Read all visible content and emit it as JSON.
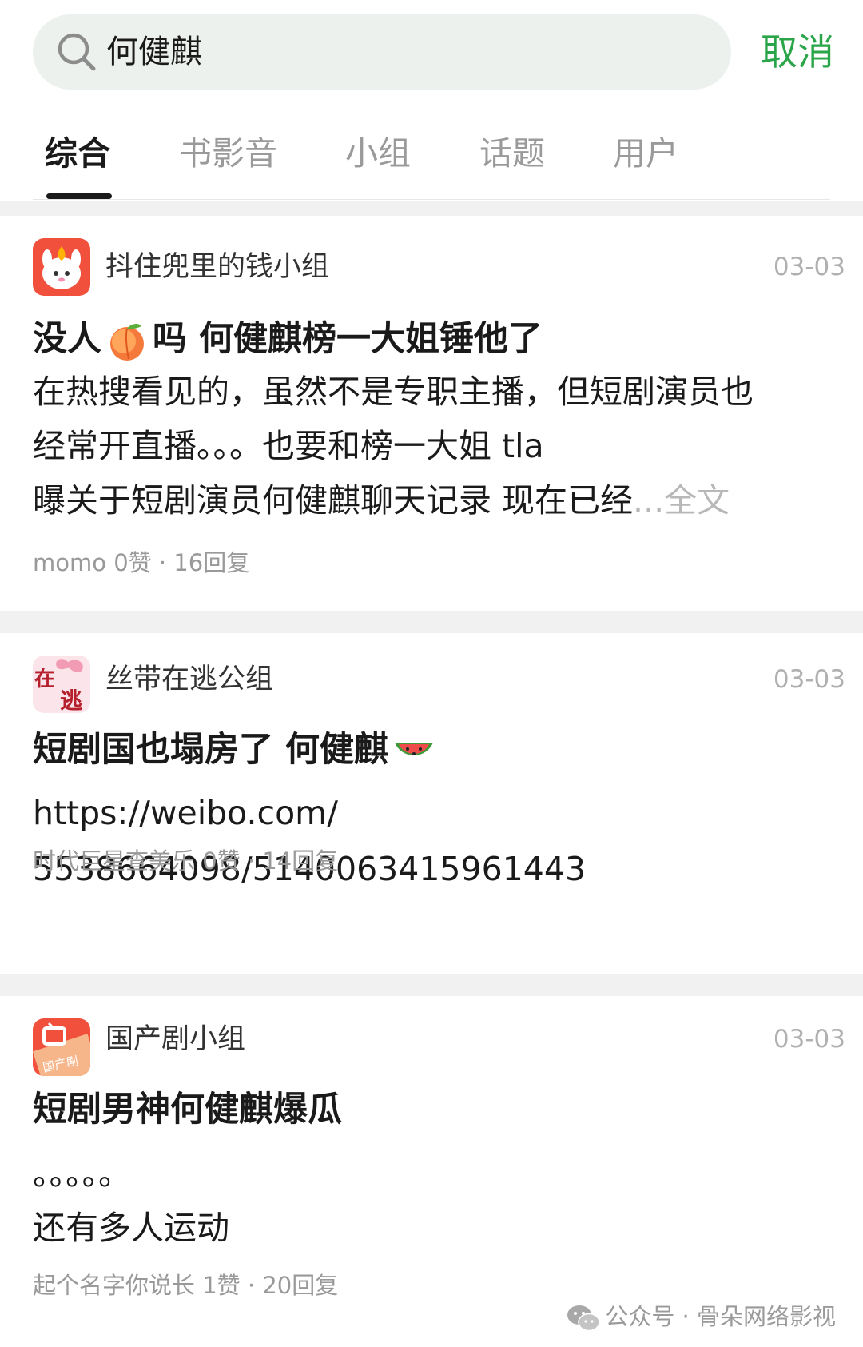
{
  "search": {
    "query": "何健麒",
    "cancel_label": "取消"
  },
  "tabs": [
    {
      "label": "综合"
    },
    {
      "label": "书影音"
    },
    {
      "label": "小组"
    },
    {
      "label": "话题"
    },
    {
      "label": "用户"
    }
  ],
  "posts": [
    {
      "group_name": "抖住兜里的钱小组",
      "date": "03-03",
      "title_before": "没人",
      "title_after": "吗 何健麒榜一大姐锤他了",
      "title_emoji": "peach-icon",
      "body_lines": [
        "在热搜看见的，虽然不是专职主播，但短剧演员也",
        "经常开直播。。。也要和榜一大姐 tla",
        " 曝关于短剧演员何健麒聊天记录 现在已经"
      ],
      "more_label": "...全文",
      "meta": "momo 0赞 · 16回复"
    },
    {
      "group_name": "丝带在逃公组",
      "date": "03-03",
      "title_before": "短剧国也塌房了  何健麒",
      "title_emoji": "watermelon-icon",
      "body_lines": [
        "https://weibo.com/",
        "5538664098/5140063415961443"
      ],
      "meta": "时代巨星查美乐 0赞 · 14回复"
    },
    {
      "group_name": "国产剧小组",
      "date": "03-03",
      "title_before": "短剧男神何健麒爆瓜",
      "body_lines": [
        "。。。。。",
        "还有多人运动"
      ],
      "meta": "起个名字你说长 1赞 · 20回复"
    }
  ],
  "watermark": "公众号 · 骨朵网络影视",
  "colors": {
    "accent_green": "#2aa549",
    "search_bg": "#edf1ed",
    "gap_bg": "#f1f1f1"
  }
}
